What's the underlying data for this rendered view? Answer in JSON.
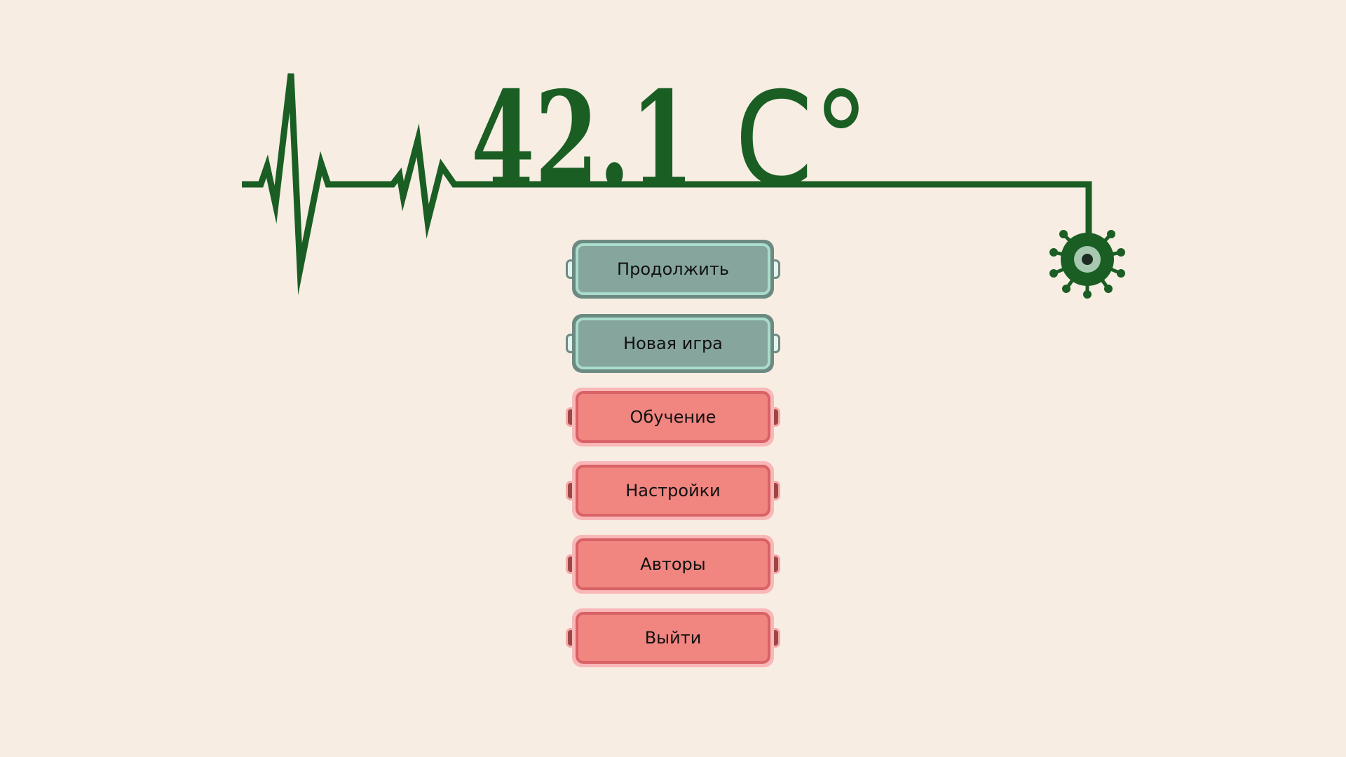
{
  "title": {
    "value_text": "42.1",
    "unit_text": "C°"
  },
  "colors": {
    "background": "#f7ede3",
    "title_green": "#1a5e24",
    "button_green": "#86a69d",
    "button_red": "#f18580"
  },
  "menu": {
    "items": [
      {
        "label": "Продолжить",
        "style": "green"
      },
      {
        "label": "Новая игра",
        "style": "green"
      },
      {
        "label": "Обучение",
        "style": "red"
      },
      {
        "label": "Настройки",
        "style": "red"
      },
      {
        "label": "Авторы",
        "style": "red"
      },
      {
        "label": "Выйти",
        "style": "red"
      }
    ]
  },
  "icons": {
    "logo_line": "heartbeat-pulse-icon",
    "virus": "virus-icon"
  }
}
